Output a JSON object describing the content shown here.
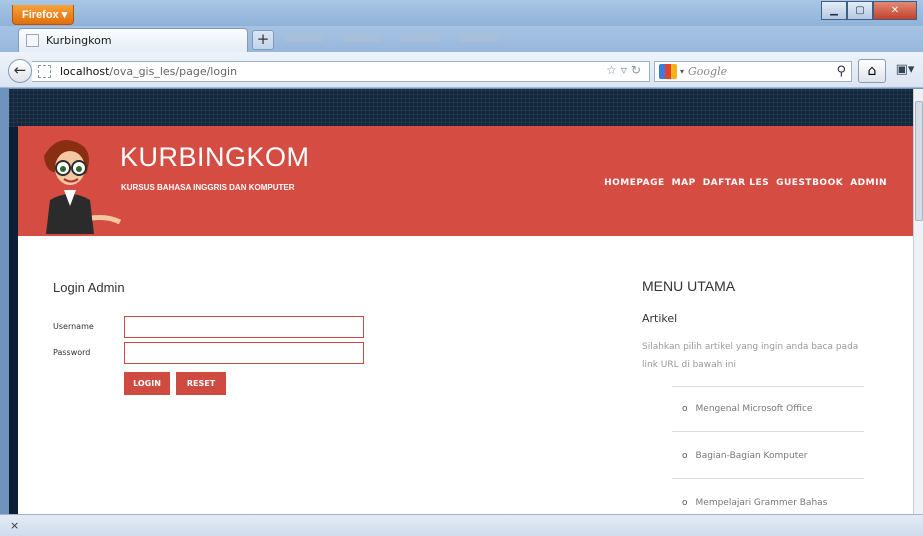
{
  "browser": {
    "menu_label": "Firefox ▾",
    "tab_title": "Kurbingkom",
    "new_tab": "+",
    "url_host": "localhost",
    "url_path": "/ova_gis_les/page/login",
    "search_engine": "Google",
    "status_close": "×"
  },
  "header": {
    "title": "KURBINGKOM",
    "subtitle": "KURSUS BAHASA INGGRIS DAN KOMPUTER",
    "nav": [
      "HOMEPAGE",
      "MAP",
      "DAFTAR LES",
      "GUESTBOOK",
      "ADMIN"
    ]
  },
  "login": {
    "title": "Login Admin",
    "username_label": "Username",
    "password_label": "Password",
    "login_button": "LOGIN",
    "reset_button": "RESET"
  },
  "sidebar": {
    "menu_title": "MENU UTAMA",
    "artikel_title": "Artikel",
    "artikel_desc": "Silahkan pilih artikel yang ingin anda baca pada link URL di bawah ini",
    "articles": [
      "Mengenal Microsoft Office",
      "Bagian-Bagian Komputer",
      "Mempelajari Grammer Bahas"
    ]
  },
  "colors": {
    "accent": "#d54c43",
    "button": "#cf4a41"
  }
}
